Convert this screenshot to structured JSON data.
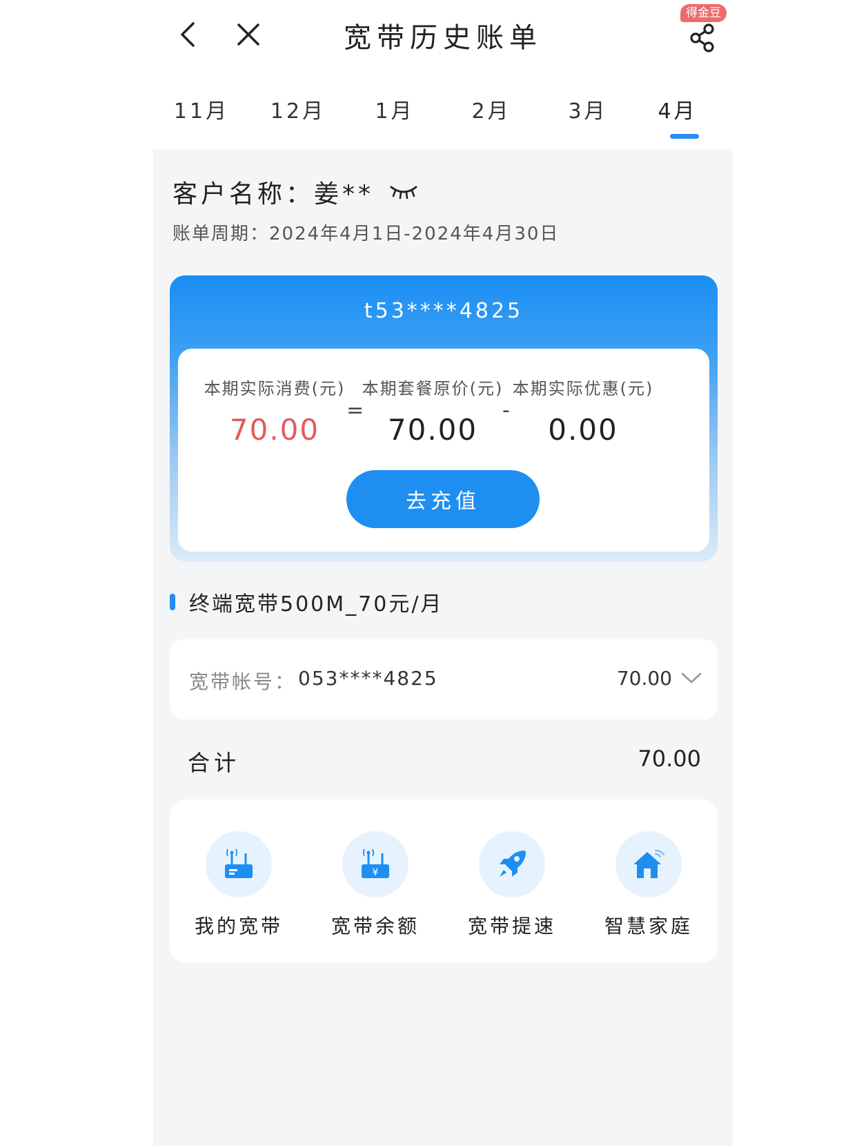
{
  "header": {
    "title": "宽带历史账单",
    "badge": "得金豆"
  },
  "tabs": [
    {
      "label": "11月"
    },
    {
      "label": "12月"
    },
    {
      "label": "1月"
    },
    {
      "label": "2月"
    },
    {
      "label": "3月"
    },
    {
      "label": "4月",
      "active": true
    }
  ],
  "customer": {
    "name_label": "客户名称：",
    "name_value": "姜**",
    "period": "账单周期：2024年4月1日-2024年4月30日"
  },
  "bill_card": {
    "account": "t53****4825",
    "actual_label": "本期实际消费(元)",
    "actual_value": "70.00",
    "equals": "=",
    "original_label": "本期套餐原价(元)",
    "original_value": "70.00",
    "minus": "-",
    "discount_label": "本期实际优惠(元)",
    "discount_value": "0.00",
    "recharge_button": "去充值",
    "accent_color": "#1f8ef1",
    "highlight_color": "#e45a5a"
  },
  "package": {
    "name": "终端宽带500M_70元/月"
  },
  "account_row": {
    "label": "宽带帐号：",
    "number": "053****4825",
    "amount": "70.00"
  },
  "total": {
    "label": "合计",
    "value": "70.00"
  },
  "quick_actions": [
    {
      "label": "我的宽带",
      "icon": "router-icon"
    },
    {
      "label": "宽带余额",
      "icon": "router-yuan-icon"
    },
    {
      "label": "宽带提速",
      "icon": "rocket-icon"
    },
    {
      "label": "智慧家庭",
      "icon": "smart-home-icon"
    }
  ]
}
